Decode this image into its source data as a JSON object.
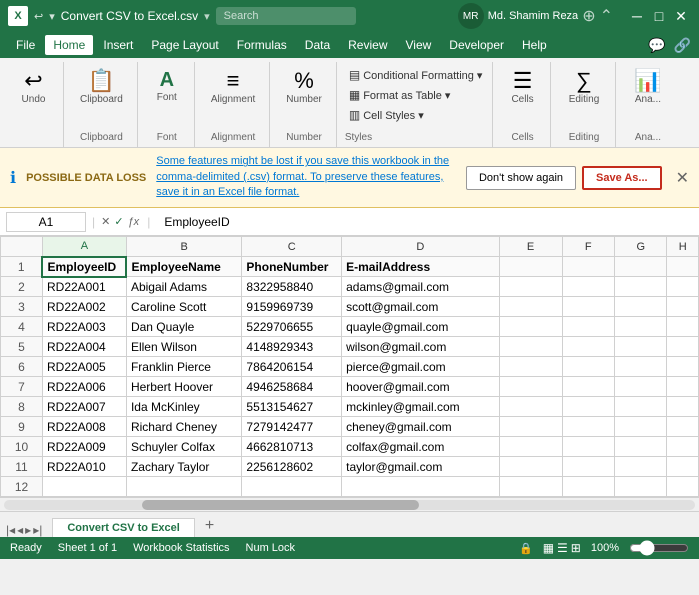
{
  "titleBar": {
    "appIcon": "X",
    "fileName": "Convert CSV to Excel.csv",
    "searchPlaceholder": "Search",
    "userName": "Md. Shamim Reza",
    "userInitials": "MR",
    "undoBtn": "↩",
    "windowBtns": [
      "—",
      "❐",
      "✕"
    ]
  },
  "menuBar": {
    "items": [
      "File",
      "Home",
      "Insert",
      "Page Layout",
      "Formulas",
      "Data",
      "Review",
      "View",
      "Developer",
      "Help"
    ],
    "activeItem": "Home",
    "rightIcons": [
      "💬",
      "🔗"
    ]
  },
  "ribbon": {
    "groups": [
      {
        "label": "Undo",
        "icon": "↩",
        "name": "undo"
      },
      {
        "label": "Clipboard",
        "icon": "📋",
        "name": "clipboard"
      },
      {
        "label": "Font",
        "icon": "A",
        "name": "font"
      },
      {
        "label": "Alignment",
        "icon": "≡",
        "name": "alignment"
      },
      {
        "label": "Number",
        "icon": "%",
        "name": "number"
      }
    ],
    "stylesGroup": {
      "label": "Styles",
      "items": [
        "Conditional Formatting ▾",
        "Format as Table ▾",
        "Cell Styles ▾"
      ]
    },
    "cellsGroup": {
      "label": "Cells",
      "icon": "☰",
      "name": "cells"
    },
    "editingGroup": {
      "label": "Editing",
      "icon": "∑",
      "name": "editing"
    },
    "analyzeGroup": {
      "label": "Ana...",
      "icon": "📊",
      "name": "analyze"
    }
  },
  "dataBanner": {
    "label": "POSSIBLE DATA LOSS",
    "message": "Some features might be lost if you save this workbook in the comma-delimited (.csv) format. To preserve these features, save it in an Excel file format.",
    "dontShowBtn": "Don't show again",
    "saveAsBtn": "Save As...",
    "closeBtn": "✕"
  },
  "formulaBar": {
    "cellRef": "A1",
    "formula": "EmployeeID",
    "controls": [
      "✕",
      "✓",
      "ƒx"
    ]
  },
  "spreadsheet": {
    "columns": [
      "",
      "A",
      "B",
      "C",
      "D",
      "E",
      "F",
      "G",
      "H"
    ],
    "rows": [
      {
        "num": "1",
        "cells": [
          "EmployeeID",
          "EmployeeName",
          "PhoneNumber",
          "E-mailAddress",
          "",
          "",
          "",
          ""
        ]
      },
      {
        "num": "2",
        "cells": [
          "RD22A001",
          "Abigail Adams",
          "8322958840",
          "adams@gmail.com",
          "",
          "",
          "",
          ""
        ]
      },
      {
        "num": "3",
        "cells": [
          "RD22A002",
          "Caroline Scott",
          "9159969739",
          "scott@gmail.com",
          "",
          "",
          "",
          ""
        ]
      },
      {
        "num": "4",
        "cells": [
          "RD22A003",
          "Dan Quayle",
          "5229706655",
          "quayle@gmail.com",
          "",
          "",
          "",
          ""
        ]
      },
      {
        "num": "5",
        "cells": [
          "RD22A004",
          "Ellen Wilson",
          "4148929343",
          "wilson@gmail.com",
          "",
          "",
          "",
          ""
        ]
      },
      {
        "num": "6",
        "cells": [
          "RD22A005",
          "Franklin Pierce",
          "7864206154",
          "pierce@gmail.com",
          "",
          "",
          "",
          ""
        ]
      },
      {
        "num": "7",
        "cells": [
          "RD22A006",
          "Herbert Hoover",
          "4946258684",
          "hoover@gmail.com",
          "",
          "",
          "",
          ""
        ]
      },
      {
        "num": "8",
        "cells": [
          "RD22A007",
          "Ida McKinley",
          "5513154627",
          "mckinley@gmail.com",
          "",
          "",
          "",
          ""
        ]
      },
      {
        "num": "9",
        "cells": [
          "RD22A008",
          "Richard Cheney",
          "7279142477",
          "cheney@gmail.com",
          "",
          "",
          "",
          ""
        ]
      },
      {
        "num": "10",
        "cells": [
          "RD22A009",
          "Schuyler Colfax",
          "4662810713",
          "colfax@gmail.com",
          "",
          "",
          "",
          ""
        ]
      },
      {
        "num": "11",
        "cells": [
          "RD22A010",
          "Zachary Taylor",
          "2256128602",
          "taylor@gmail.com",
          "",
          "",
          "",
          ""
        ]
      },
      {
        "num": "12",
        "cells": [
          "",
          "",
          "",
          "",
          "",
          "",
          "",
          ""
        ]
      }
    ]
  },
  "sheetTabs": {
    "tabs": [
      "Convert CSV to Excel"
    ],
    "activeTab": "Convert CSV to Excel",
    "newTabIcon": "+"
  },
  "statusBar": {
    "left": [
      "Ready",
      "Sheet 1 of 1",
      "Workbook Statistics",
      "Num Lock"
    ],
    "lockIcon": "🔒",
    "viewIcons": [
      "▦",
      "☰",
      "⊞"
    ],
    "zoomValue": "100%"
  }
}
